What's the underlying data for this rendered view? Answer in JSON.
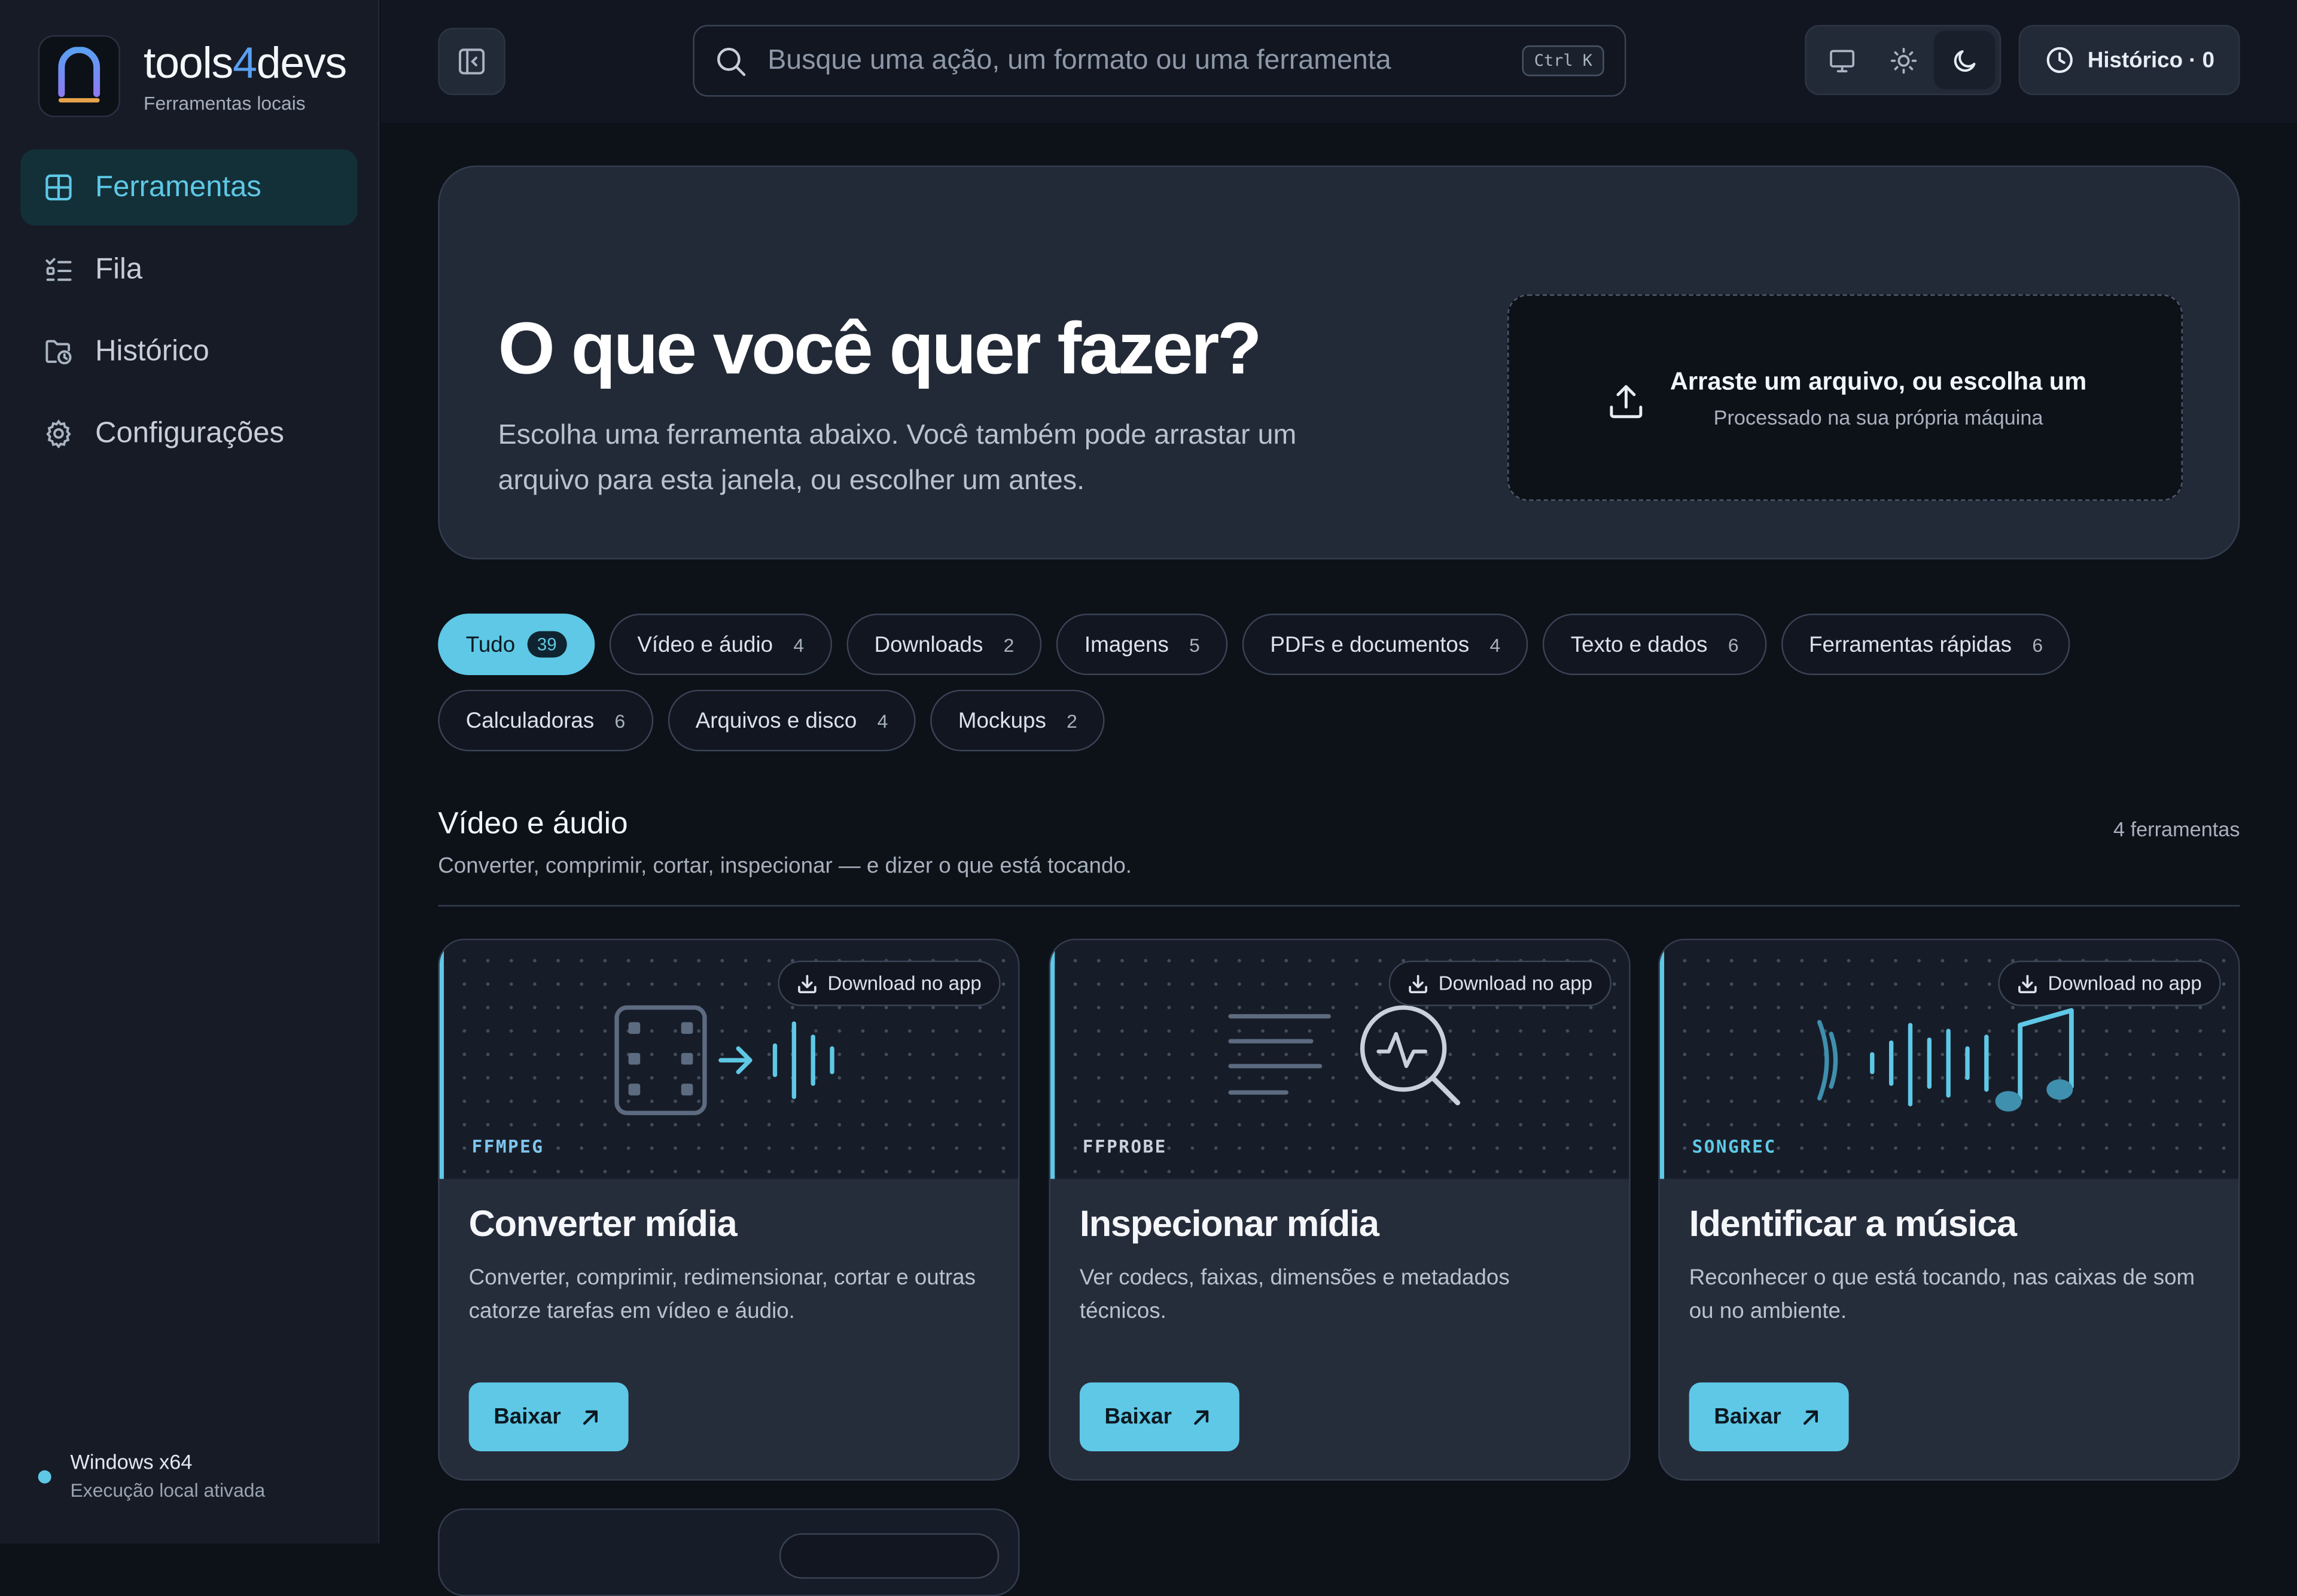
{
  "brand": {
    "name_prefix": "tools",
    "name_four": "4",
    "name_suffix": "devs",
    "subtitle": "Ferramentas locais"
  },
  "sidebar": {
    "items": [
      {
        "label": "Ferramentas",
        "icon": "grid-icon",
        "active": true
      },
      {
        "label": "Fila",
        "icon": "list-checks-icon",
        "active": false
      },
      {
        "label": "Histórico",
        "icon": "folder-clock-icon",
        "active": false
      },
      {
        "label": "Configurações",
        "icon": "gear-icon",
        "active": false
      }
    ],
    "system": {
      "title": "Windows x64",
      "subtitle": "Execução local ativada"
    }
  },
  "topbar": {
    "search_placeholder": "Busque uma ação, um formato ou uma ferramenta",
    "search_shortcut": "Ctrl K",
    "theme_options": [
      "monitor-icon",
      "sun-icon",
      "moon-icon"
    ],
    "theme_selected": "moon-icon",
    "history_label": "Histórico · 0"
  },
  "hero": {
    "title": "O que você quer fazer?",
    "subtitle": "Escolha uma ferramenta abaixo. Você também pode arrastar um arquivo para esta janela, ou escolher um antes.",
    "drop_title": "Arraste um arquivo, ou escolha um",
    "drop_subtitle": "Processado na sua própria máquina"
  },
  "filters": [
    {
      "label": "Tudo",
      "count": "39",
      "active": true
    },
    {
      "label": "Vídeo e áudio",
      "count": "4"
    },
    {
      "label": "Downloads",
      "count": "2"
    },
    {
      "label": "Imagens",
      "count": "5"
    },
    {
      "label": "PDFs e documentos",
      "count": "4"
    },
    {
      "label": "Texto e dados",
      "count": "6"
    },
    {
      "label": "Ferramentas rápidas",
      "count": "6"
    },
    {
      "label": "Calculadoras",
      "count": "6"
    },
    {
      "label": "Arquivos e disco",
      "count": "4"
    },
    {
      "label": "Mockups",
      "count": "2"
    }
  ],
  "section": {
    "title": "Vídeo e áudio",
    "subtitle": "Converter, comprimir, cortar, inspecionar — e dizer o que está tocando.",
    "count": "4 ferramentas"
  },
  "cards": [
    {
      "engine": "FFMPEG",
      "engine_color": "#7fc6ee",
      "title": "Converter mídia",
      "description": "Converter, comprimir, redimensionar, cortar e outras catorze tarefas em vídeo e áudio.",
      "download_label": "Download no app",
      "button_label": "Baixar",
      "art": "film-to-audio-icon"
    },
    {
      "engine": "FFPROBE",
      "engine_color": "#c9d1dc",
      "title": "Inspecionar mídia",
      "description": "Ver codecs, faixas, dimensões e metadados técnicos.",
      "download_label": "Download no app",
      "button_label": "Baixar",
      "art": "magnifier-pulse-icon"
    },
    {
      "engine": "SONGREC",
      "engine_color": "#5ec8e6",
      "title": "Identificar a música",
      "description": "Reconhecer o que está tocando, nas caixas de som ou no ambiente.",
      "download_label": "Download no app",
      "button_label": "Baixar",
      "art": "music-note-wave-icon"
    }
  ],
  "colors": {
    "accent": "#5ec8e6",
    "background": "#0d1118",
    "panel": "#232a37",
    "sidebar": "#161b26"
  }
}
